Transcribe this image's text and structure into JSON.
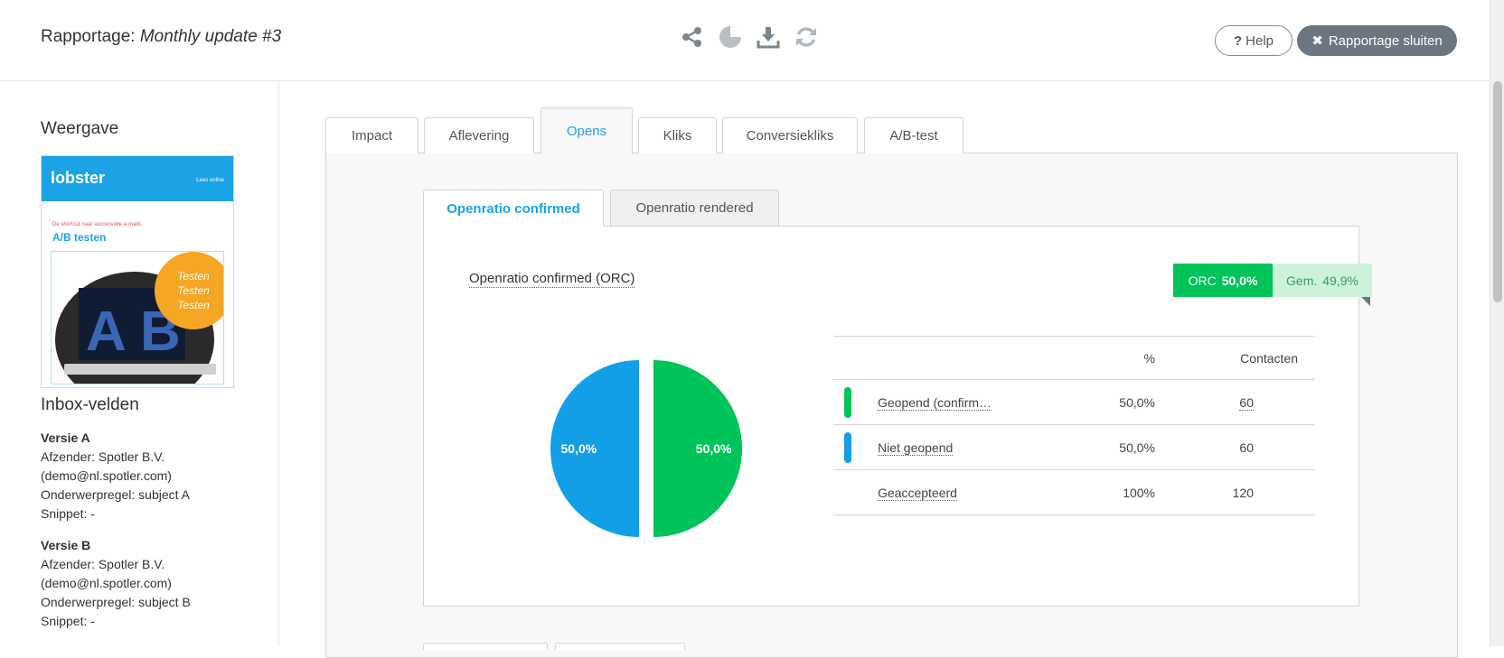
{
  "header": {
    "report_prefix": "Rapportage:",
    "report_name": "Monthly update #3",
    "tools": [
      "share-icon",
      "pie-chart-icon",
      "download-icon",
      "refresh-icon"
    ],
    "help_label": "Help",
    "close_label": "Rapportage sluiten"
  },
  "sidebar": {
    "weergave_title": "Weergave",
    "preview": {
      "logo": "lobster",
      "lees_online": "Lees online",
      "shortcut": "De shortcut naar succesvolle e-mails",
      "headline": "A/B testen",
      "circle_lines": [
        "Testen",
        "Testen",
        "Testen"
      ]
    },
    "inbox_title": "Inbox-velden",
    "versions": [
      {
        "title": "Versie A",
        "sender": "Afzender: Spotler B.V.",
        "email": "(demo@nl.spotler.com)",
        "subject": "Onderwerpregel: subject A",
        "snippet": "Snippet: -"
      },
      {
        "title": "Versie B",
        "sender": "Afzender: Spotler B.V.",
        "email": "(demo@nl.spotler.com)",
        "subject": "Onderwerpregel: subject B",
        "snippet": "Snippet: -"
      }
    ]
  },
  "main": {
    "tabs": [
      {
        "label": "Impact"
      },
      {
        "label": "Aflevering"
      },
      {
        "label": "Opens"
      },
      {
        "label": "Kliks"
      },
      {
        "label": "Conversiekliks"
      },
      {
        "label": "A/B-test"
      }
    ],
    "active_tab": "Opens",
    "subtabs": [
      {
        "label": "Openratio confirmed"
      },
      {
        "label": "Openratio rendered"
      }
    ],
    "active_subtab": "Openratio confirmed",
    "card": {
      "title": "Openratio confirmed (ORC)",
      "orc_label": "ORC",
      "orc_value": "50,0%",
      "gem_label": "Gem.",
      "gem_value": "49,9%"
    },
    "table": {
      "col_pct": "%",
      "col_contacts": "Contacten",
      "rows": [
        {
          "label": "Geopend (confirm…",
          "pct": "50,0%",
          "contacts": "60",
          "color": "#00c35a"
        },
        {
          "label": "Niet geopend",
          "pct": "50,0%",
          "contacts": "60",
          "color": "#139ee8"
        },
        {
          "label": "Geaccepteerd",
          "pct": "100%",
          "contacts": "120",
          "color": ""
        }
      ]
    }
  },
  "chart_data": {
    "type": "pie",
    "categories": [
      "Geopend (confirm…",
      "Niet geopend"
    ],
    "values": [
      50.0,
      50.0
    ],
    "labels": [
      "50,0%",
      "50,0%"
    ],
    "colors": [
      "#00c35a",
      "#139ee8"
    ]
  }
}
